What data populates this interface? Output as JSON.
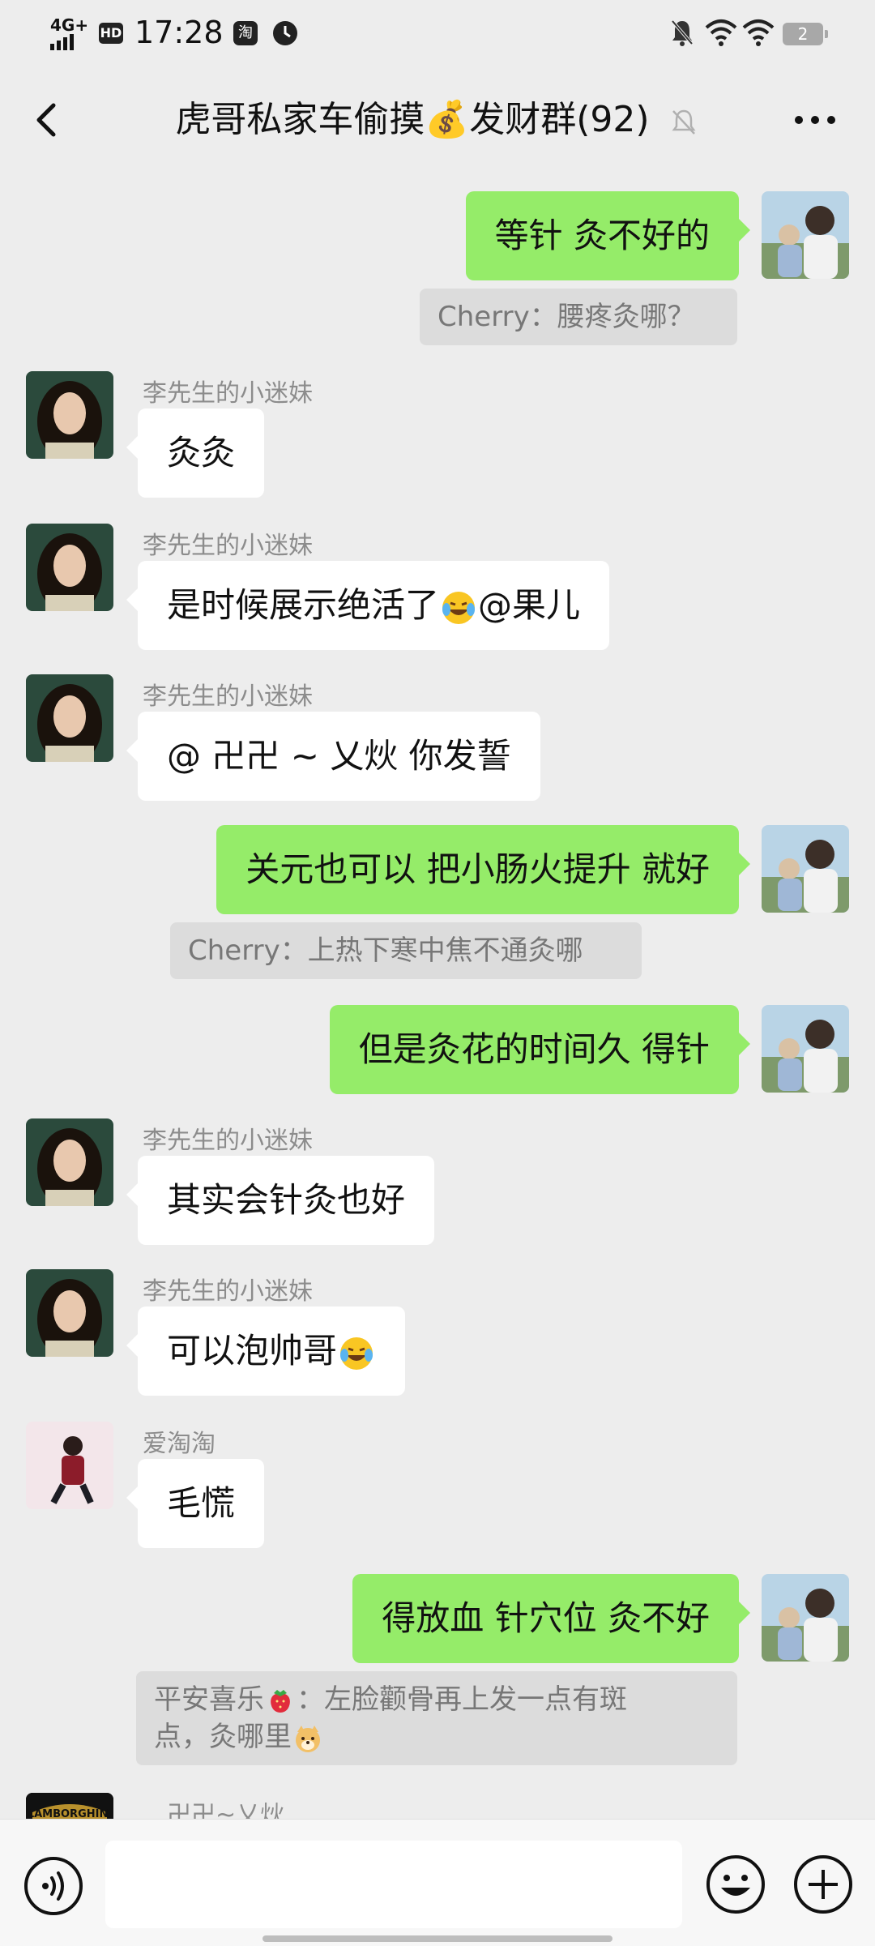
{
  "status_bar": {
    "network": "4G+",
    "hd_badge": "HD",
    "time": "17:28",
    "app_icon": "淘",
    "battery": "2"
  },
  "header": {
    "title": "虎哥私家车偷摸💰发财群(92)"
  },
  "messages": [
    {
      "text": "等针  灸不好的"
    },
    {
      "quote": "Cherry：腰疼灸哪？"
    },
    {
      "sender": "李先生的小迷妹",
      "text": "灸灸"
    },
    {
      "sender": "李先生的小迷妹",
      "text": "是时候展示绝活了",
      "text_after": "@果儿"
    },
    {
      "sender": "李先生的小迷妹",
      "text": "@    卍卍 ~ 乂炏  你发誓"
    },
    {
      "text": "关元也可以  把小肠火提升 就好"
    },
    {
      "quote": "Cherry：上热下寒中焦不通灸哪"
    },
    {
      "text": "但是灸花的时间久  得针"
    },
    {
      "sender": "李先生的小迷妹",
      "text": "其实会针灸也好"
    },
    {
      "sender": "李先生的小迷妹",
      "text": "可以泡帅哥"
    },
    {
      "sender": "爱淘淘",
      "text": "毛慌"
    },
    {
      "text": "得放血 针穴位  灸不好"
    },
    {
      "quote_line1": "平安喜乐",
      "quote_line1_after": "：左脸颧骨再上发一点有斑",
      "quote_line2": "点，灸哪里"
    },
    {
      "sender": "卍卍~乂炏"
    }
  ],
  "logo_text": "LAMBORGHINI",
  "input": {
    "placeholder": ""
  },
  "colors": {
    "background": "#ededed",
    "outgoing_bubble": "#95ec69",
    "incoming_bubble": "#ffffff",
    "quote_bg": "#dcdcdc"
  }
}
